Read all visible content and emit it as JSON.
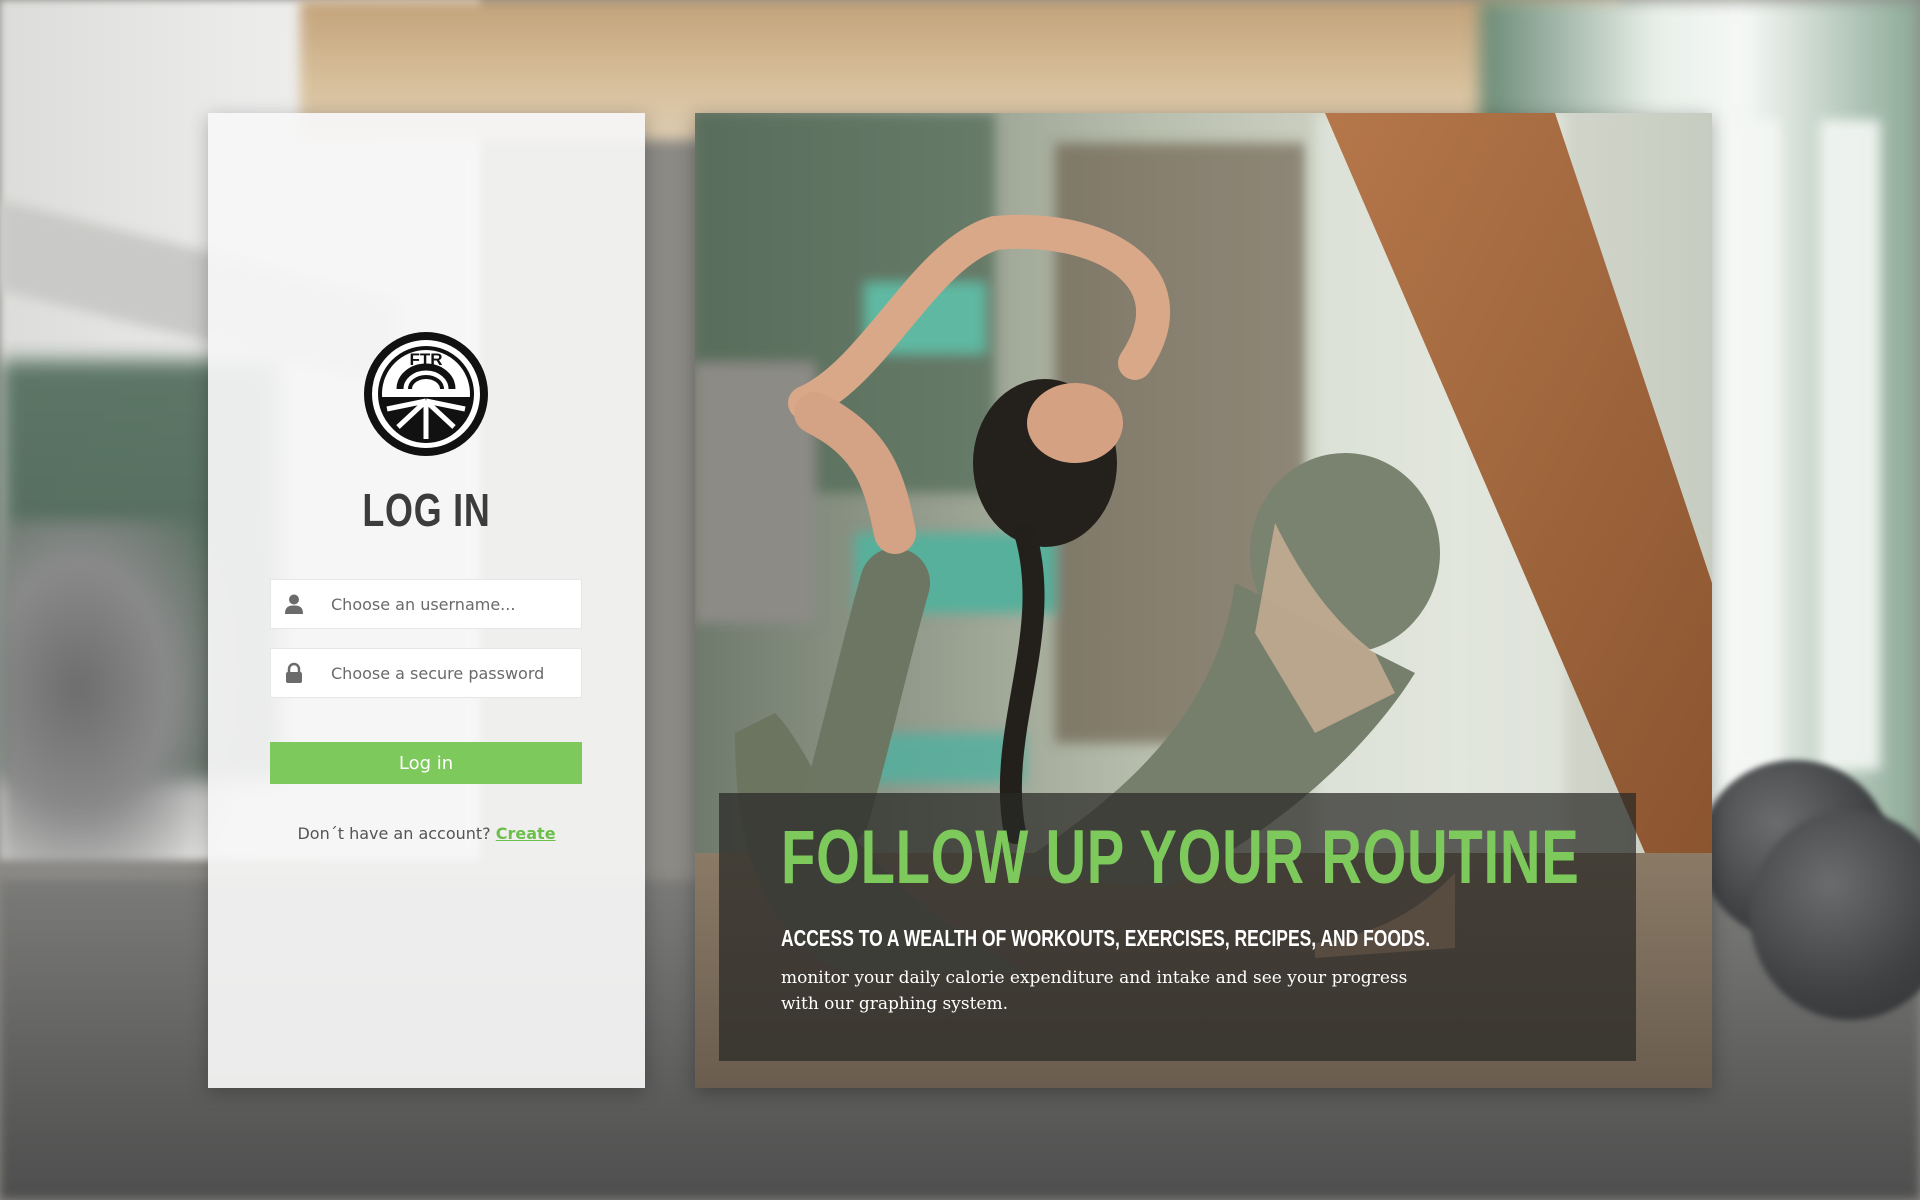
{
  "brand": {
    "logo_text": "FTR"
  },
  "login": {
    "title": "LOG IN",
    "username_placeholder": "Choose an username...",
    "password_placeholder": "Choose a secure password",
    "submit_label": "Log in",
    "no_account_text": "Don´t have an account?",
    "create_link": "Create"
  },
  "hero": {
    "title": "FOLLOW UP YOUR ROUTINE",
    "subtitle": "ACCESS TO A WEALTH OF WORKOUTS, EXERCISES, RECIPES, AND FOODS.",
    "description": "monitor your daily calorie expenditure and intake and see your progress with our graphing system."
  },
  "icons": {
    "username": "user-icon",
    "password": "lock-icon",
    "logo": "ftr-logo"
  },
  "colors": {
    "accent": "#7dc95c",
    "title": "#3c3c3c",
    "caption_bg": "#282826"
  }
}
